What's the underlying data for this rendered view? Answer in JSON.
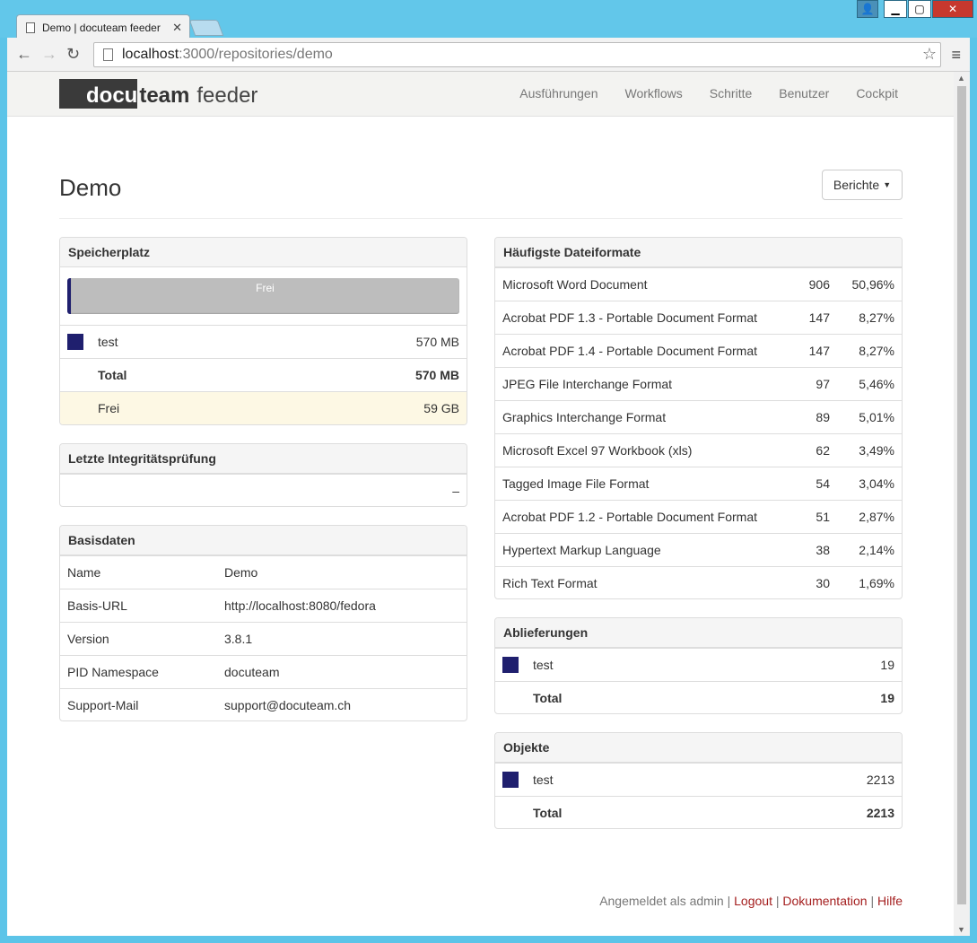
{
  "browser": {
    "tab_title": "Demo | docuteam feeder",
    "url_host": "localhost",
    "url_path": ":3000/repositories/demo"
  },
  "navbar": {
    "logo_docu": "docu",
    "logo_team": "team",
    "logo_feeder": "feeder",
    "links": [
      "Ausführungen",
      "Workflows",
      "Schritte",
      "Benutzer",
      "Cockpit"
    ]
  },
  "page": {
    "title": "Demo",
    "reports_button": "Berichte"
  },
  "storage": {
    "title": "Speicherplatz",
    "bar_label": "Frei",
    "used_fraction": 0.0094,
    "rows": [
      {
        "label": "test",
        "value": "570 MB"
      }
    ],
    "total_label": "Total",
    "total_value": "570 MB",
    "free_label": "Frei",
    "free_value": "59 GB"
  },
  "integrity": {
    "title": "Letzte Integritätsprüfung",
    "value": "–"
  },
  "basics": {
    "title": "Basisdaten",
    "rows": [
      {
        "key": "Name",
        "value": "Demo"
      },
      {
        "key": "Basis-URL",
        "value": "http://localhost:8080/fedora"
      },
      {
        "key": "Version",
        "value": "3.8.1"
      },
      {
        "key": "PID Namespace",
        "value": "docuteam"
      },
      {
        "key": "Support-Mail",
        "value": "support@docuteam.ch"
      }
    ]
  },
  "formats": {
    "title": "Häufigste Dateiformate",
    "rows": [
      {
        "name": "Microsoft Word Document",
        "count": "906",
        "pct": "50,96%"
      },
      {
        "name": "Acrobat PDF 1.3 - Portable Document Format",
        "count": "147",
        "pct": "8,27%"
      },
      {
        "name": "Acrobat PDF 1.4 - Portable Document Format",
        "count": "147",
        "pct": "8,27%"
      },
      {
        "name": "JPEG File Interchange Format",
        "count": "97",
        "pct": "5,46%"
      },
      {
        "name": "Graphics Interchange Format",
        "count": "89",
        "pct": "5,01%"
      },
      {
        "name": "Microsoft Excel 97 Workbook (xls)",
        "count": "62",
        "pct": "3,49%"
      },
      {
        "name": "Tagged Image File Format",
        "count": "54",
        "pct": "3,04%"
      },
      {
        "name": "Acrobat PDF 1.2 - Portable Document Format",
        "count": "51",
        "pct": "2,87%"
      },
      {
        "name": "Hypertext Markup Language",
        "count": "38",
        "pct": "2,14%"
      },
      {
        "name": "Rich Text Format",
        "count": "30",
        "pct": "1,69%"
      }
    ]
  },
  "deliveries": {
    "title": "Ablieferungen",
    "rows": [
      {
        "label": "test",
        "value": "19"
      }
    ],
    "total_label": "Total",
    "total_value": "19"
  },
  "objects": {
    "title": "Objekte",
    "rows": [
      {
        "label": "test",
        "value": "2213"
      }
    ],
    "total_label": "Total",
    "total_value": "2213"
  },
  "footer": {
    "logged_in": "Angemeldet als admin",
    "sep": "|",
    "logout": "Logout",
    "docs": "Dokumentation",
    "help": "Hilfe"
  },
  "colors": {
    "series": "#1f1f6e",
    "link": "#a41e1e"
  }
}
